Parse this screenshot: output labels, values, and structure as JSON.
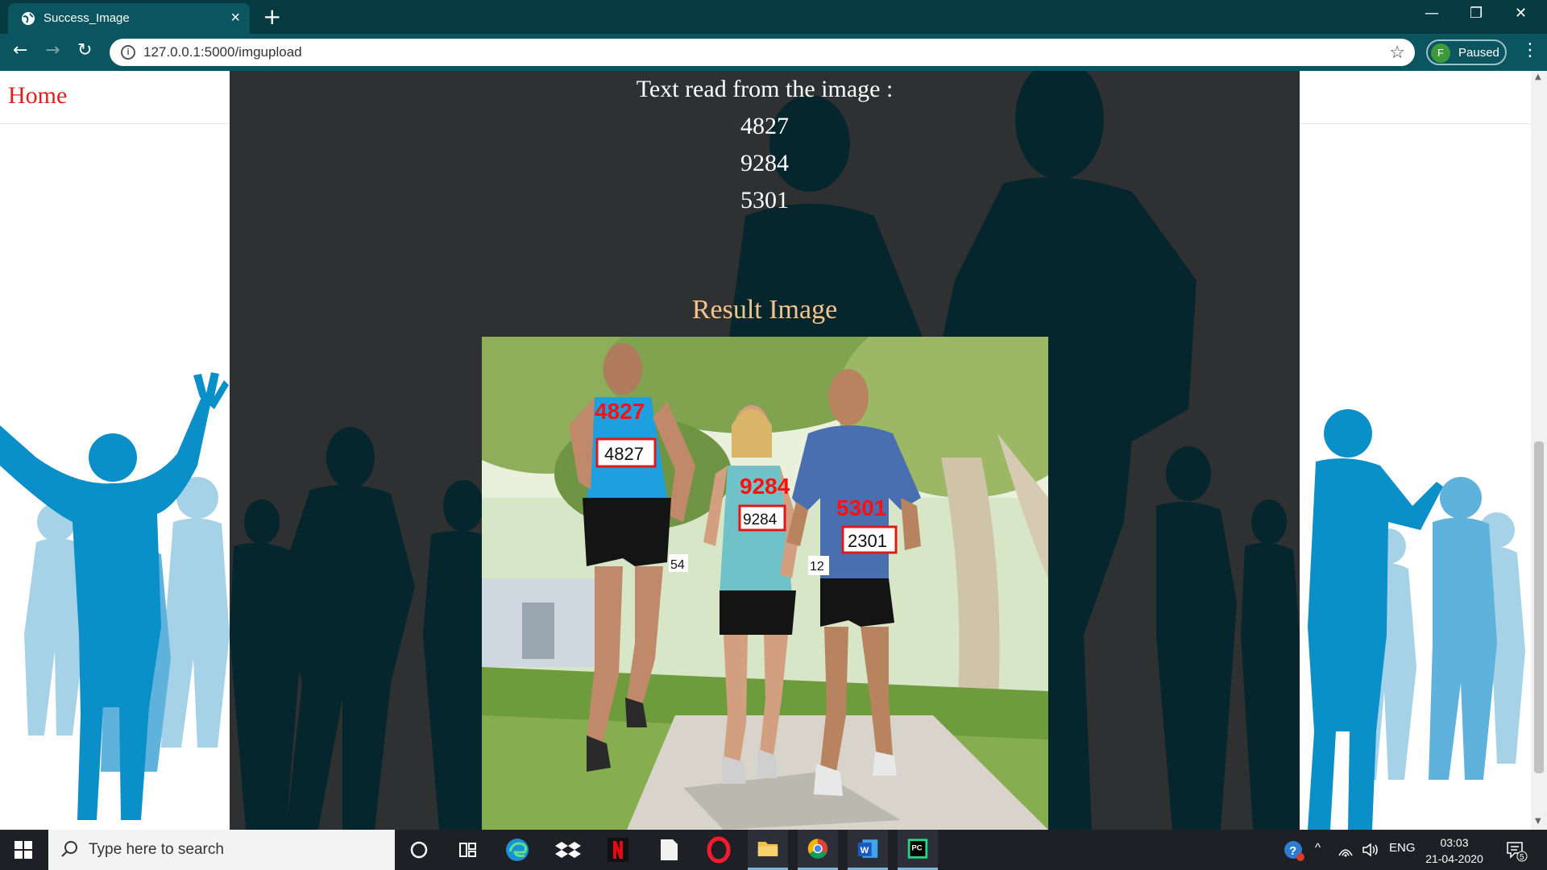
{
  "browser": {
    "tab_title": "Success_Image",
    "url": "127.0.0.1:5000/imgupload",
    "profile_initial": "F",
    "profile_status": "Paused"
  },
  "page": {
    "home_link": "Home",
    "heading": "Text read from the image :",
    "numbers": [
      "4827",
      "9284",
      "5301"
    ],
    "result_title": "Result Image",
    "photo_labels": [
      {
        "detected": "4827",
        "bib": "4827"
      },
      {
        "detected": "9284",
        "bib": "9284"
      },
      {
        "detected": "5301",
        "bib": "2301"
      }
    ],
    "partial_bibs": [
      "54",
      "12"
    ]
  },
  "taskbar": {
    "search_placeholder": "Type here to search",
    "tray_lang": "ENG",
    "time": "03:03",
    "date": "21-04-2020",
    "notification_count": "5",
    "pinned_apps": [
      "cortana",
      "task-view",
      "edge",
      "dropbox",
      "netflix",
      "notepad",
      "opera",
      "file-explorer",
      "chrome",
      "word",
      "pycharm"
    ]
  },
  "colors": {
    "tabbar": "#043a40",
    "toolbar": "#0a5560",
    "home_link": "#e02020",
    "result_title": "#f4c48c",
    "center_panel": "#2f3031",
    "silhouette_blue": "#0b8fc9"
  }
}
